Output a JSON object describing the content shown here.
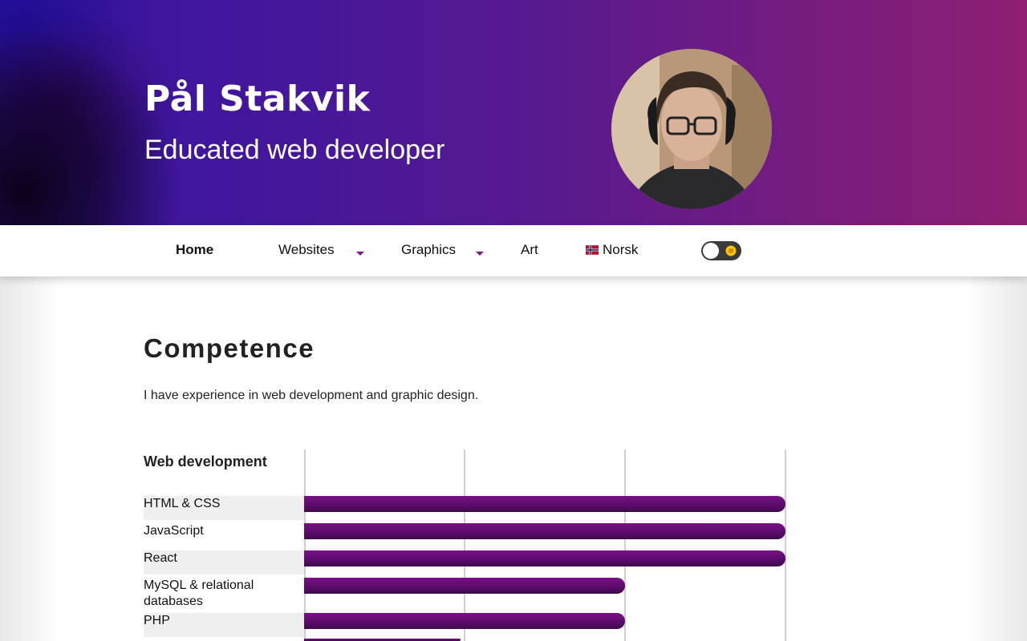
{
  "header": {
    "name": "Pål Stakvik",
    "subtitle": "Educated web developer",
    "avatar_alt": "profile photo"
  },
  "nav": {
    "items": [
      {
        "label": "Home",
        "active": true
      },
      {
        "label": "Websites",
        "dropdown": true
      },
      {
        "label": "Graphics",
        "dropdown": true
      },
      {
        "label": "Art"
      },
      {
        "label": "Norsk",
        "icon": "norway-flag-icon"
      }
    ],
    "theme_toggle": {
      "state": "off",
      "icon": "sun-icon"
    }
  },
  "main": {
    "heading": "Competence",
    "intro": "I have experience in web development and graphic design."
  },
  "chart_data": {
    "type": "bar",
    "orientation": "horizontal",
    "title": "Web development",
    "categories": [
      "HTML & CSS",
      "JavaScript",
      "React",
      "MySQL & relational databases",
      "PHP"
    ],
    "values": [
      3,
      3,
      3,
      2,
      2
    ],
    "xlim": [
      0,
      3
    ],
    "grid": true,
    "bar_color": "#6a0d7a"
  },
  "colors": {
    "header_start": "#3514a0",
    "header_end": "#8f1f72",
    "accent": "#7a1a8a"
  }
}
